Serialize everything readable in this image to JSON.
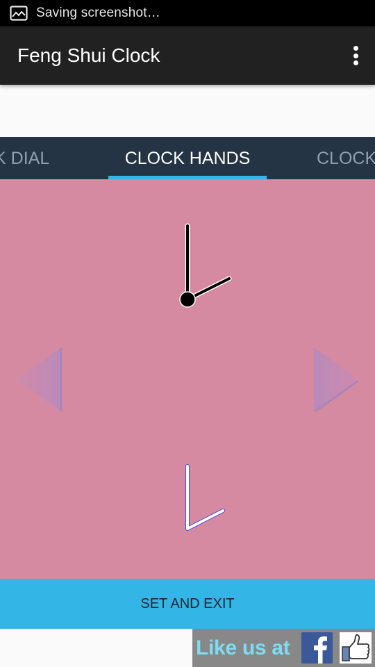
{
  "status_bar": {
    "notification_icon": "image-icon",
    "text": "Saving screenshot…"
  },
  "action_bar": {
    "title": "Feng Shui Clock",
    "overflow_icon": "more-vert-icon"
  },
  "tabs": [
    {
      "label": "CLOCK DIAL",
      "visible_label": "CK DIAL",
      "active": false
    },
    {
      "label": "CLOCK HANDS",
      "visible_label": "CLOCK HANDS",
      "active": true
    },
    {
      "label": "CLOCK",
      "visible_label": "CLOCK",
      "active": false
    }
  ],
  "colors": {
    "status_bar": "#000000",
    "action_bar": "#212121",
    "tab_strip": "#243444",
    "tab_indicator": "#33b5e5",
    "clock_panel": "#d68aa1",
    "set_exit_button": "#33b5e5",
    "like_banner": "#888888",
    "like_text": "#7fdcf2",
    "facebook_blue": "#3b5998"
  },
  "clock_panel": {
    "hands_styles": [
      {
        "name": "black-hands",
        "hand_color": "#000000",
        "outline": "#ffffff",
        "center_dot": true,
        "time_shown": "2:00"
      },
      {
        "name": "white-hands",
        "hand_color": "#ffffff",
        "outline": "#4a4ad8",
        "center_dot": false,
        "time_shown": "2:00"
      }
    ],
    "prev_icon": "arrow-left-triangle-icon",
    "next_icon": "arrow-right-triangle-icon"
  },
  "set_exit_button": {
    "label": "SET AND EXIT"
  },
  "like_banner": {
    "text": "Like us at",
    "facebook_icon": "facebook-icon",
    "thumb_icon": "thumbs-up-icon"
  }
}
